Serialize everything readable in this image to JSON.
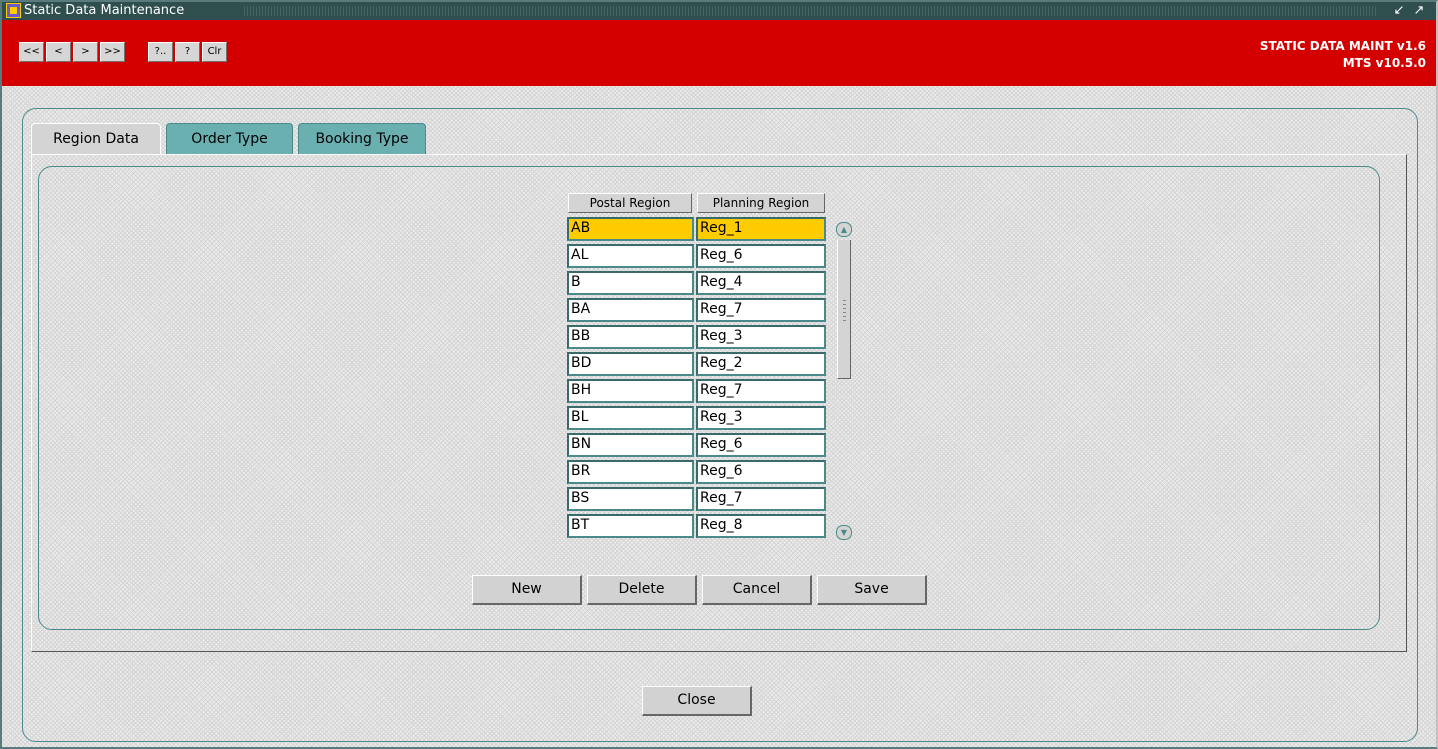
{
  "window": {
    "title": "Static Data Maintenance",
    "controls": [
      "minimize-icon",
      "maximize-icon"
    ]
  },
  "toolbar": {
    "buttons": [
      {
        "label": "<<",
        "name": "first-record-button"
      },
      {
        "label": "<",
        "name": "previous-record-button"
      },
      {
        "label": ">",
        "name": "next-record-button"
      },
      {
        "label": ">>",
        "name": "last-record-button"
      },
      {
        "label": "?..",
        "name": "query-button"
      },
      {
        "label": "?",
        "name": "execute-query-button"
      },
      {
        "label": "Clr",
        "name": "clear-button"
      }
    ],
    "brand_line1": "STATIC DATA MAINT v1.6",
    "brand_line2": "MTS v10.5.0"
  },
  "tabs": [
    {
      "label": "Region Data",
      "active": true
    },
    {
      "label": "Order Type",
      "active": false
    },
    {
      "label": "Booking Type",
      "active": false
    }
  ],
  "grid": {
    "columns": [
      "Postal Region",
      "Planning Region"
    ],
    "rows": [
      {
        "postal": "AB",
        "planning": "Reg_1",
        "selected": true
      },
      {
        "postal": "AL",
        "planning": "Reg_6"
      },
      {
        "postal": "B",
        "planning": "Reg_4"
      },
      {
        "postal": "BA",
        "planning": "Reg_7"
      },
      {
        "postal": "BB",
        "planning": "Reg_3"
      },
      {
        "postal": "BD",
        "planning": "Reg_2"
      },
      {
        "postal": "BH",
        "planning": "Reg_7"
      },
      {
        "postal": "BL",
        "planning": "Reg_3"
      },
      {
        "postal": "BN",
        "planning": "Reg_6"
      },
      {
        "postal": "BR",
        "planning": "Reg_6"
      },
      {
        "postal": "BS",
        "planning": "Reg_7"
      },
      {
        "postal": "BT",
        "planning": "Reg_8"
      }
    ]
  },
  "actions": {
    "new_label": "New",
    "delete_label": "Delete",
    "cancel_label": "Cancel",
    "save_label": "Save",
    "close_label": "Close"
  },
  "colors": {
    "toolbar_bg": "#d40000",
    "titlebar_bg": "#2f4f4f",
    "selected_row": "#ffcc00",
    "inactive_tab": "#6ab0b0",
    "frame_border": "#4a8a8a"
  }
}
